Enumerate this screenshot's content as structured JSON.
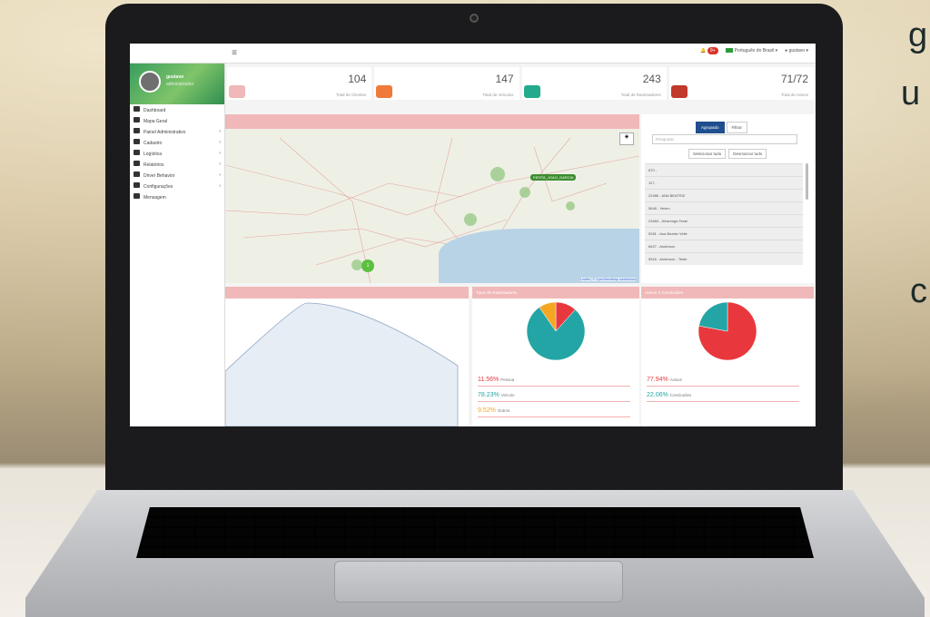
{
  "background_text": [
    "g",
    "u",
    "c"
  ],
  "topbar": {
    "menu_icon": "≡",
    "notif_badge": "9+",
    "language": "Português do Brasil",
    "user": "gustavo"
  },
  "sidebar": {
    "profile_name": "gustavo",
    "profile_sub": "administrador",
    "items": [
      {
        "label": "Dashboard",
        "icon": "dashboard-icon"
      },
      {
        "label": "Mapa Geral",
        "icon": "map-icon"
      },
      {
        "label": "Painel Administrativo",
        "icon": "panel-icon",
        "expand": "‹"
      },
      {
        "label": "Cadastro",
        "icon": "edit-icon",
        "expand": "‹"
      },
      {
        "label": "Logística",
        "icon": "logistics-icon",
        "expand": "‹"
      },
      {
        "label": "Relatórios",
        "icon": "reports-icon",
        "expand": "‹"
      },
      {
        "label": "Driver Behavior",
        "icon": "driver-icon",
        "expand": "‹"
      },
      {
        "label": "Configurações",
        "icon": "settings-icon",
        "expand": "‹"
      },
      {
        "label": "Mensagem",
        "icon": "message-icon"
      }
    ]
  },
  "stats": [
    {
      "value": "104",
      "label": "Total de Clientes",
      "icon": "user-icon",
      "color": "#f0b8b8"
    },
    {
      "value": "147",
      "label": "Total de Veículos",
      "icon": "truck-icon",
      "color": "#f07a3a"
    },
    {
      "value": "243",
      "label": "Total de Rastreadores",
      "icon": "inbox-icon",
      "color": "#23a98b"
    },
    {
      "value": "71/72",
      "label": "Total de Avisos",
      "icon": "gear-icon",
      "color": "#c0392b"
    }
  ],
  "map": {
    "pins": [
      "FIESTA_JOAO_GARCIA"
    ],
    "cluster": "1",
    "attribution": "Leaflet | © OpenStreetMap contributors"
  },
  "vehicle_panel": {
    "tab_grouped": "Agrupado",
    "tab_filter": "Filtrar",
    "search_placeholder": "Pesquisar",
    "select_all": "Selecionar tudo",
    "deselect_all": "Desmarcar tudo",
    "items": [
      "870 -",
      "117 -",
      "22486 - ANA BEATRIZ",
      "5648 - Veiom",
      "23484 - Alvarenga Teste",
      "5281 - Ana Beatriz Velle",
      "6627 - Anderson",
      "5916 - Anderson - Teste"
    ]
  },
  "chart_tipos": {
    "title": "Tipos de Rastreadores",
    "legend": [
      {
        "pct": "11.56%",
        "name": "Pessoa",
        "color": "#e8383d"
      },
      {
        "pct": "78.23%",
        "name": "Veículo",
        "color": "#23a5a5"
      },
      {
        "pct": "9.52%",
        "name": "Outros",
        "color": "#f5a623"
      }
    ]
  },
  "chart_avisos": {
    "title": "Avisos X Conclusões",
    "legend": [
      {
        "pct": "77.94%",
        "name": "Avisos",
        "color": "#e8383d"
      },
      {
        "pct": "22.06%",
        "name": "Conclusões",
        "color": "#23a5a5"
      }
    ]
  },
  "chart_data": [
    {
      "type": "pie",
      "title": "Tipos de Rastreadores",
      "categories": [
        "Pessoa",
        "Veículo",
        "Outros"
      ],
      "values": [
        11.56,
        78.23,
        9.52
      ],
      "colors": [
        "#e8383d",
        "#23a5a5",
        "#f5a623"
      ]
    },
    {
      "type": "pie",
      "title": "Avisos X Conclusões",
      "categories": [
        "Avisos",
        "Conclusões"
      ],
      "values": [
        77.94,
        22.06
      ],
      "colors": [
        "#e8383d",
        "#23a5a5"
      ]
    }
  ]
}
